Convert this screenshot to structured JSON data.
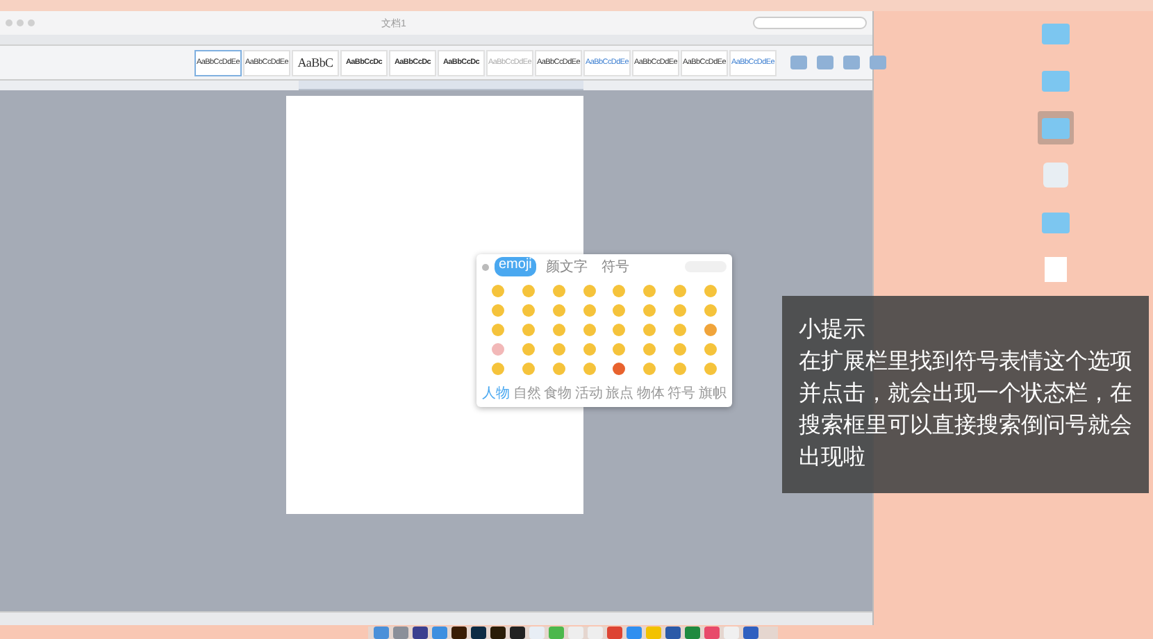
{
  "window": {
    "title": "文档1"
  },
  "styles": [
    {
      "preview": "AaBbCcDdEe",
      "kind": "normal",
      "selected": true
    },
    {
      "preview": "AaBbCcDdEe",
      "kind": "normal",
      "selected": false
    },
    {
      "preview": "AaBbC",
      "kind": "large",
      "selected": false
    },
    {
      "preview": "AaBbCcDc",
      "kind": "bold",
      "selected": false
    },
    {
      "preview": "AaBbCcDc",
      "kind": "bold",
      "selected": false
    },
    {
      "preview": "AaBbCcDc",
      "kind": "bold",
      "selected": false
    },
    {
      "preview": "AaBbCcDdEe",
      "kind": "faint",
      "selected": false
    },
    {
      "preview": "AaBbCcDdEe",
      "kind": "normal",
      "selected": false
    },
    {
      "preview": "AaBbCcDdEe",
      "kind": "blue",
      "selected": false
    },
    {
      "preview": "AaBbCcDdEe",
      "kind": "normal",
      "selected": false
    },
    {
      "preview": "AaBbCcDdEe",
      "kind": "normal",
      "selected": false
    },
    {
      "preview": "AaBbCcDdEe",
      "kind": "blue",
      "selected": false
    }
  ],
  "emoji_panel": {
    "tabs": [
      {
        "label": "emoji",
        "selected": true
      },
      {
        "label": "颜文字",
        "selected": false
      },
      {
        "label": "符号",
        "selected": false
      }
    ],
    "emojis": [
      {
        "color": "#f5c33b"
      },
      {
        "color": "#f5c33b"
      },
      {
        "color": "#f5c33b"
      },
      {
        "color": "#f5c33b"
      },
      {
        "color": "#f5c33b"
      },
      {
        "color": "#f5c33b"
      },
      {
        "color": "#f5c33b"
      },
      {
        "color": "#f5c33b"
      },
      {
        "color": "#f5c33b"
      },
      {
        "color": "#f5c33b"
      },
      {
        "color": "#f5c33b"
      },
      {
        "color": "#f5c33b"
      },
      {
        "color": "#f5c33b"
      },
      {
        "color": "#f5c33b"
      },
      {
        "color": "#f5c33b"
      },
      {
        "color": "#f5c33b"
      },
      {
        "color": "#f5c33b"
      },
      {
        "color": "#f5c33b"
      },
      {
        "color": "#f5c33b"
      },
      {
        "color": "#f5c33b"
      },
      {
        "color": "#f5c33b"
      },
      {
        "color": "#f5c33b"
      },
      {
        "color": "#f5c33b"
      },
      {
        "color": "#f0a43a"
      },
      {
        "color": "#f2b8b8"
      },
      {
        "color": "#f5c33b"
      },
      {
        "color": "#f5c33b"
      },
      {
        "color": "#f5c33b"
      },
      {
        "color": "#f5c33b"
      },
      {
        "color": "#f5c33b"
      },
      {
        "color": "#f5c33b"
      },
      {
        "color": "#f5c33b"
      },
      {
        "color": "#f5c33b"
      },
      {
        "color": "#f5c33b"
      },
      {
        "color": "#f5c33b"
      },
      {
        "color": "#f5c33b"
      },
      {
        "color": "#e8622e"
      },
      {
        "color": "#f5c33b"
      },
      {
        "color": "#f5c33b"
      },
      {
        "color": "#f5c33b"
      }
    ],
    "categories": [
      {
        "label": "人物",
        "selected": true
      },
      {
        "label": "自然",
        "selected": false
      },
      {
        "label": "食物",
        "selected": false
      },
      {
        "label": "活动",
        "selected": false
      },
      {
        "label": "旅点",
        "selected": false
      },
      {
        "label": "物体",
        "selected": false
      },
      {
        "label": "符号",
        "selected": false
      },
      {
        "label": "旗帜",
        "selected": false
      }
    ]
  },
  "desktop_icons": [
    {
      "kind": "folder",
      "selected": false
    },
    {
      "kind": "folder",
      "selected": false
    },
    {
      "kind": "folder",
      "selected": true
    },
    {
      "kind": "app",
      "selected": false
    },
    {
      "kind": "folder",
      "selected": false
    },
    {
      "kind": "file",
      "selected": false
    }
  ],
  "dock_apps": [
    {
      "color": "#4a90d9"
    },
    {
      "color": "#8a8f99"
    },
    {
      "color": "#3b3f8f"
    },
    {
      "color": "#3d8fe0"
    },
    {
      "color": "#3a1d05"
    },
    {
      "color": "#0d2b44"
    },
    {
      "color": "#2b1d08"
    },
    {
      "color": "#222222"
    },
    {
      "color": "#e8eef5"
    },
    {
      "color": "#4cb84c"
    },
    {
      "color": "#eeeeee"
    },
    {
      "color": "#eeeeee"
    },
    {
      "color": "#dd4433"
    },
    {
      "color": "#2f8ff0"
    },
    {
      "color": "#f2c200"
    },
    {
      "color": "#2b5aa8"
    },
    {
      "color": "#1f8a3f"
    },
    {
      "color": "#e84a6a"
    },
    {
      "color": "#f0f0f0"
    },
    {
      "color": "#3060c0"
    }
  ],
  "tip": {
    "title": "小提示",
    "body": "在扩展栏里找到符号表情这个选项并点击，就会出现一个状态栏，在搜索框里可以直接搜索倒问号就会出现啦"
  }
}
